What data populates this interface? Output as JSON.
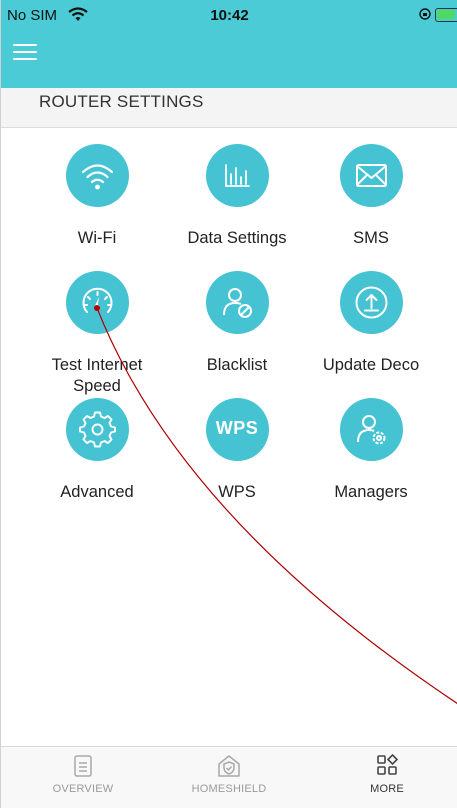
{
  "status_bar": {
    "carrier": "No SIM",
    "time": "10:42"
  },
  "header": {
    "section_title": "ROUTER SETTINGS"
  },
  "tiles": [
    {
      "label": "Wi-Fi",
      "icon": "wifi-icon"
    },
    {
      "label": "Data Settings",
      "icon": "bar-chart-icon"
    },
    {
      "label": "SMS",
      "icon": "envelope-icon"
    },
    {
      "label": "Test Internet Speed",
      "icon": "speedometer-icon"
    },
    {
      "label": "Blacklist",
      "icon": "user-block-icon"
    },
    {
      "label": "Update Deco",
      "icon": "upload-icon"
    },
    {
      "label": "Advanced",
      "icon": "gear-icon"
    },
    {
      "label": "WPS",
      "icon": "wps-icon",
      "icon_text": "WPS"
    },
    {
      "label": "Managers",
      "icon": "user-gear-icon"
    }
  ],
  "tabbar": {
    "items": [
      {
        "label": "OVERVIEW",
        "icon": "document-icon"
      },
      {
        "label": "HOMESHIELD",
        "icon": "house-shield-icon"
      },
      {
        "label": "MORE",
        "icon": "grid-icon"
      }
    ],
    "active": "MORE"
  },
  "colors": {
    "header": "#4acbd6",
    "icon_circle": "#46c3d2",
    "cursor_trail": "#b00000"
  }
}
